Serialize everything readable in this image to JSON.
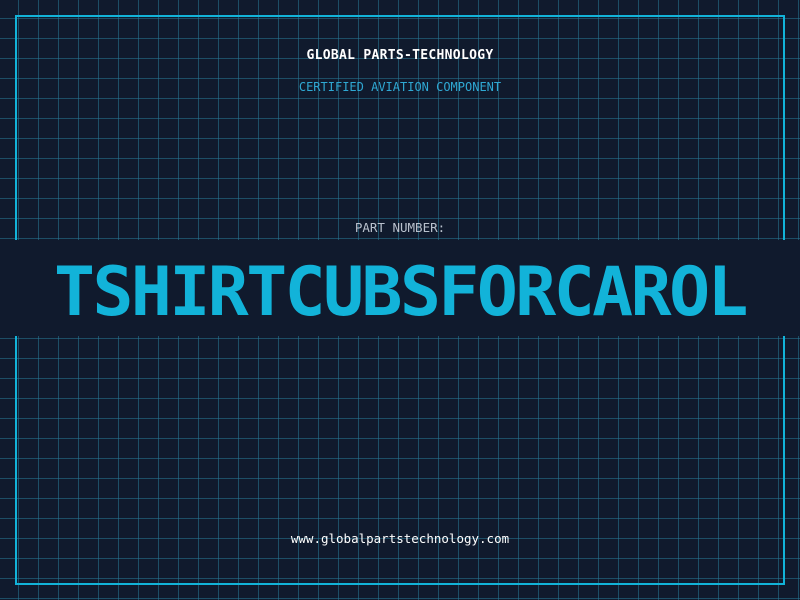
{
  "header": {
    "brand_name": "GLOBAL PARTS-TECHNOLOGY",
    "certification": "CERTIFIED AVIATION COMPONENT"
  },
  "part": {
    "label": "PART NUMBER:",
    "number": "TSHIRTCUBSFORCAROL"
  },
  "footer": {
    "website": "www.globalpartstechnology.com"
  },
  "colors": {
    "background": "#101a2d",
    "grid": "#28788f",
    "accent": "#12b3d9",
    "label": "#b8c0cc",
    "text": "#ffffff"
  }
}
